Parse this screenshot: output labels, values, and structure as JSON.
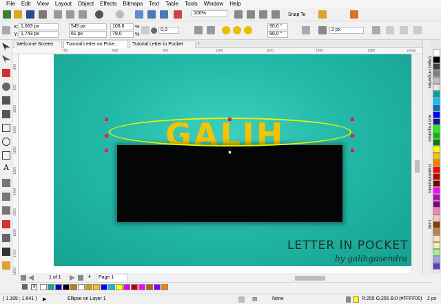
{
  "menu": [
    "File",
    "Edit",
    "View",
    "Layout",
    "Object",
    "Effects",
    "Bitmaps",
    "Text",
    "Table",
    "Tools",
    "Window",
    "Help"
  ],
  "toolbar": {
    "zoom": "100%",
    "snap_to": "Snap To"
  },
  "properties": {
    "x": "1,083 px",
    "y": "1,743 px",
    "width": "545 px",
    "height": "61 px",
    "scale_w": "108,0",
    "scale_h": "79,0",
    "percent": "%",
    "rotation": "0,0",
    "angle1": "90,0 °",
    "angle2": "90,0 °",
    "outline": "2 px",
    "x_label": "X:",
    "y_label": "Y:"
  },
  "tabs": [
    "Welcome Screen",
    "Tutorial Letter on Pcke...",
    "Tutorial Letter in Pocket"
  ],
  "ruler": {
    "marks": [
      "700",
      "800",
      "900",
      "1000",
      "1100",
      "1200",
      "1300"
    ],
    "unit": "pixels",
    "vmarks": [
      "800",
      "900",
      "1000",
      "1100",
      "1200",
      "1300",
      "1400",
      "1500",
      "1600",
      "1700",
      "1800"
    ]
  },
  "artwork": {
    "headline": "GALIH",
    "title": "LETTER IN POCKET",
    "byline": "by galihgasendra"
  },
  "dockers": [
    "Object Properties",
    "Text Properties",
    "Transformations",
    "Lens"
  ],
  "page_nav": {
    "counter": "1 of 1",
    "page_tab": "Page 1"
  },
  "status": {
    "coords": "( 1.199 ; 1.641 )",
    "selection": "Ellipse on Layer 1",
    "fill": "None",
    "outline_color": "R:255 G:255 B:0 (#FFFF00)",
    "outline_width": "2 px"
  },
  "colors": {
    "artboard": "#22b9a8",
    "headline": "#f5c400",
    "ellipse_outline": "#e8f000",
    "handle": "#e3223c"
  },
  "palette_right": [
    "#ffffff",
    "#000000",
    "#404040",
    "#808080",
    "#c0c0c0",
    "#e8e8e8",
    "#00a0a0",
    "#00c8ff",
    "#0070c0",
    "#0000ff",
    "#002080",
    "#00ff00",
    "#00c000",
    "#008000",
    "#ffff00",
    "#ffc000",
    "#ff8000",
    "#ff0000",
    "#c00000",
    "#800000",
    "#ff00ff",
    "#c000c0",
    "#800080",
    "#ff80c0",
    "#ffc0c0",
    "#804000",
    "#c08040",
    "#ffe0c0",
    "#f0f0a0",
    "#a0f0a0",
    "#a0a0f0",
    "#6040c0"
  ],
  "palette_doc": [
    "#ffffff",
    "#20a090",
    "#0000c0",
    "#000000",
    "#c08000",
    "#ffffff",
    "#d0a000",
    "#ffc000",
    "#0000ff",
    "#00c0e0",
    "#ffff00",
    "#e000e0",
    "#c00000",
    "#ff00ff",
    "#c06000",
    "#8000ff",
    "#ff8000"
  ]
}
